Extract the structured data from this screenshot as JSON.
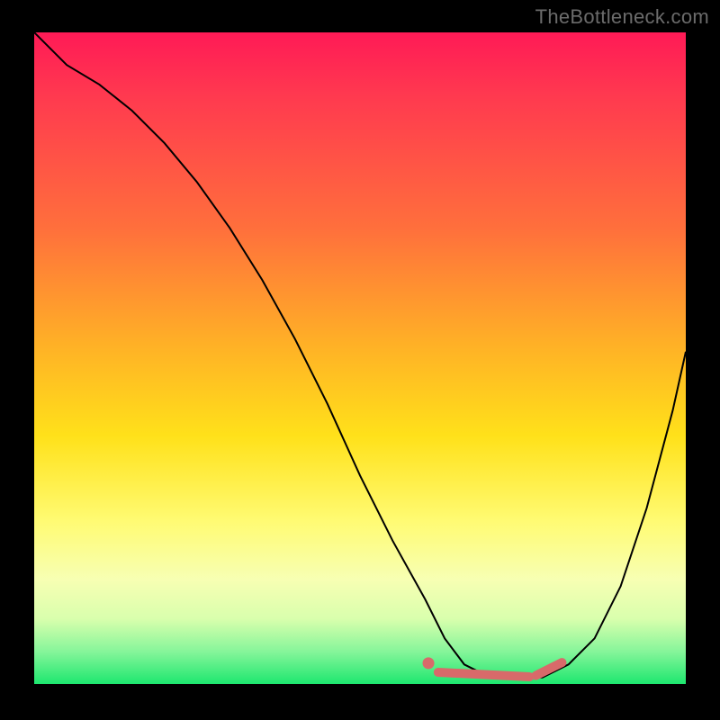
{
  "watermark": "TheBottleneck.com",
  "chart_data": {
    "type": "line",
    "title": "",
    "xlabel": "",
    "ylabel": "",
    "xlim": [
      0,
      100
    ],
    "ylim": [
      0,
      100
    ],
    "grid": false,
    "legend": false,
    "annotations": [],
    "series": [
      {
        "name": "bottleneck-curve",
        "x": [
          0,
          5,
          10,
          15,
          20,
          25,
          30,
          35,
          40,
          45,
          50,
          55,
          60,
          63,
          66,
          70,
          74,
          78,
          82,
          86,
          90,
          94,
          98,
          100
        ],
        "y": [
          100,
          95,
          92,
          88,
          83,
          77,
          70,
          62,
          53,
          43,
          32,
          22,
          13,
          7,
          3,
          1,
          1,
          1,
          3,
          7,
          15,
          27,
          42,
          51
        ]
      }
    ],
    "markers": {
      "comment": "highlighted optimal region near the valley floor",
      "dot": {
        "x": 60.5,
        "y": 3.2
      },
      "segment_a": {
        "x1": 62,
        "y1": 1.8,
        "x2": 76,
        "y2": 1.1
      },
      "segment_b": {
        "x1": 77,
        "y1": 1.3,
        "x2": 81,
        "y2": 3.3
      }
    },
    "colors": {
      "curve": "#000000",
      "marker": "#d86a6a",
      "gradient_top": "#ff1a56",
      "gradient_bottom": "#1de76f"
    }
  }
}
